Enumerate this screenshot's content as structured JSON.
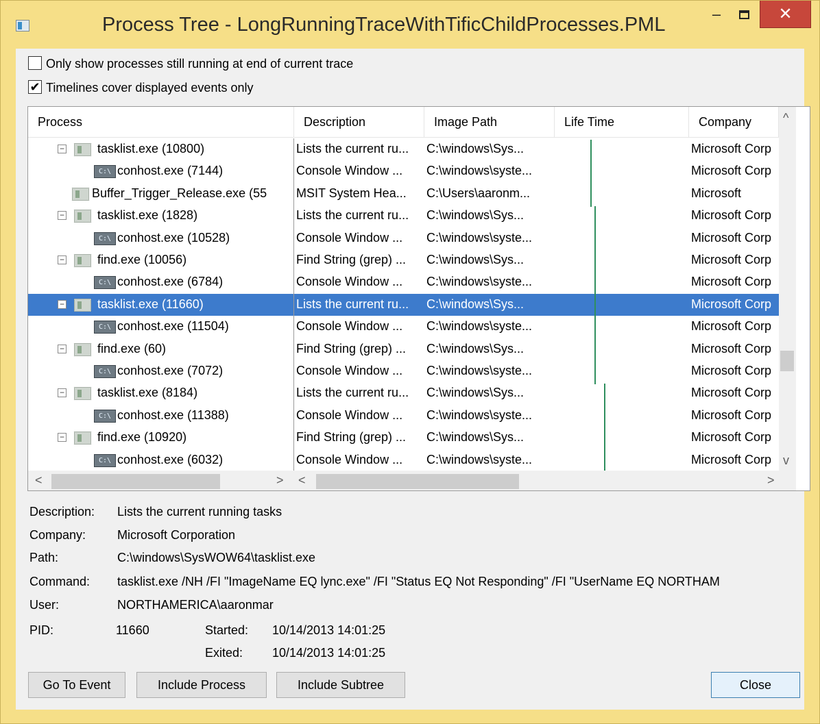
{
  "window": {
    "title": "Process Tree - LongRunningTraceWithTificChildProcesses.PML",
    "minimize_glyph": "–",
    "close_glyph": "✕"
  },
  "options": {
    "only_running_label": "Only show processes still running at end of current trace",
    "only_running_checked": false,
    "timelines_label": "Timelines cover displayed events only",
    "timelines_checked": true,
    "check_glyph": "✔"
  },
  "table": {
    "columns": [
      "Process",
      "Description",
      "Image Path",
      "Life Time",
      "Company"
    ],
    "rows": [
      {
        "process": "tasklist.exe (10800)",
        "icon": "process-icon",
        "expander": "⊟",
        "description": "Lists the current ru...",
        "path": "C:\\windows\\Sys...",
        "company": "Microsoft Corp",
        "selected": false
      },
      {
        "process": "conhost.exe (7144)",
        "icon": "console-icon",
        "expander": "",
        "description": "Console Window ...",
        "path": "C:\\windows\\syste...",
        "company": "Microsoft Corp",
        "selected": false
      },
      {
        "process": "Buffer_Trigger_Release.exe (55",
        "icon": "process-icon",
        "expander": "",
        "description": "MSIT System Hea...",
        "path": "C:\\Users\\aaronm...",
        "company": "Microsoft",
        "selected": false
      },
      {
        "process": "tasklist.exe (1828)",
        "icon": "process-icon",
        "expander": "⊟",
        "description": "Lists the current ru...",
        "path": "C:\\windows\\Sys...",
        "company": "Microsoft Corp",
        "selected": false
      },
      {
        "process": "conhost.exe (10528)",
        "icon": "console-icon",
        "expander": "",
        "description": "Console Window ...",
        "path": "C:\\windows\\syste...",
        "company": "Microsoft Corp",
        "selected": false
      },
      {
        "process": "find.exe (10056)",
        "icon": "process-icon",
        "expander": "⊟",
        "description": "Find String (grep) ...",
        "path": "C:\\windows\\Sys...",
        "company": "Microsoft Corp",
        "selected": false
      },
      {
        "process": "conhost.exe (6784)",
        "icon": "console-icon",
        "expander": "",
        "description": "Console Window ...",
        "path": "C:\\windows\\syste...",
        "company": "Microsoft Corp",
        "selected": false
      },
      {
        "process": "tasklist.exe (11660)",
        "icon": "process-icon",
        "expander": "⊟",
        "description": "Lists the current ru...",
        "path": "C:\\windows\\Sys...",
        "company": "Microsoft Corp",
        "selected": true
      },
      {
        "process": "conhost.exe (11504)",
        "icon": "console-icon",
        "expander": "",
        "description": "Console Window ...",
        "path": "C:\\windows\\syste...",
        "company": "Microsoft Corp",
        "selected": false
      },
      {
        "process": "find.exe (60)",
        "icon": "process-icon",
        "expander": "⊟",
        "description": "Find String (grep) ...",
        "path": "C:\\windows\\Sys...",
        "company": "Microsoft Corp",
        "selected": false
      },
      {
        "process": "conhost.exe (7072)",
        "icon": "console-icon",
        "expander": "",
        "description": "Console Window ...",
        "path": "C:\\windows\\syste...",
        "company": "Microsoft Corp",
        "selected": false
      },
      {
        "process": "tasklist.exe (8184)",
        "icon": "process-icon",
        "expander": "⊟",
        "description": "Lists the current ru...",
        "path": "C:\\windows\\Sys...",
        "company": "Microsoft Corp",
        "selected": false
      },
      {
        "process": "conhost.exe (11388)",
        "icon": "console-icon",
        "expander": "",
        "description": "Console Window ...",
        "path": "C:\\windows\\syste...",
        "company": "Microsoft Corp",
        "selected": false
      },
      {
        "process": "find.exe (10920)",
        "icon": "process-icon",
        "expander": "⊟",
        "description": "Find String (grep) ...",
        "path": "C:\\windows\\Sys...",
        "company": "Microsoft Corp",
        "selected": false
      },
      {
        "process": "conhost.exe (6032)",
        "icon": "console-icon",
        "expander": "",
        "description": "Console Window ...",
        "path": "C:\\windows\\syste...",
        "company": "Microsoft Corp",
        "selected": false
      }
    ],
    "scroll_up_glyph": "^",
    "scroll_down_glyph": "v",
    "scroll_left_glyph": "<",
    "scroll_right_glyph": ">",
    "selection_color": "#3d7bcc",
    "lifetime_color": "#2f8f5e"
  },
  "details": {
    "description_label": "Description:",
    "description_value": "Lists the current running tasks",
    "company_label": "Company:",
    "company_value": "Microsoft Corporation",
    "path_label": "Path:",
    "path_value": "C:\\windows\\SysWOW64\\tasklist.exe",
    "command_label": "Command:",
    "command_value": "tasklist.exe /NH /FI \"ImageName EQ lync.exe\" /FI \"Status EQ Not Responding\" /FI \"UserName EQ NORTHAM",
    "user_label": "User:",
    "user_value": "NORTHAMERICA\\aaronmar",
    "pid_label": "PID:",
    "pid_value": "11660",
    "started_label": "Started:",
    "started_value": "10/14/2013 14:01:25",
    "exited_label": "Exited:",
    "exited_value": "10/14/2013 14:01:25"
  },
  "buttons": {
    "go_to_event": "Go To Event",
    "include_process": "Include Process",
    "include_subtree": "Include Subtree",
    "close": "Close"
  }
}
